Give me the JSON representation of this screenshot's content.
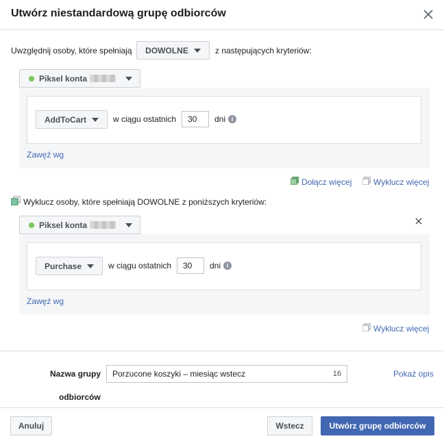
{
  "dialog": {
    "title": "Utwórz niestandardową grupę odbiorców"
  },
  "include": {
    "prefix": "Uwzględnij osoby, które spełniają",
    "match_select": "DOWOLNE",
    "suffix": "z następujących kryteriów:",
    "source_label": "Piksel konta",
    "event_select": "AddToCart",
    "within_label": "w ciągu ostatnich",
    "days_value": "30",
    "days_unit": "dni",
    "refine_link": "Zawęź wg",
    "add_more": "Dołącz więcej",
    "exclude_more": "Wyklucz więcej"
  },
  "exclude": {
    "header_text": "Wyklucz osoby, które spełniają DOWOLNE z poniższych kryteriów:",
    "source_label": "Piksel konta",
    "event_select": "Purchase",
    "within_label": "w ciągu ostatnich",
    "days_value": "30",
    "days_unit": "dni",
    "refine_link": "Zawęź wg",
    "exclude_more": "Wyklucz więcej"
  },
  "audience_name": {
    "label_line1": "Nazwa grupy",
    "label_line2": "odbiorców",
    "value": "Porzucone koszyki – miesiąc wstecz",
    "char_count": "16",
    "show_desc": "Pokaż opis"
  },
  "footer": {
    "cancel": "Anuluj",
    "back": "Wstecz",
    "create": "Utwórz grupę odbiorców"
  },
  "colors": {
    "accent": "#4267b2",
    "status_dot": "#7bc65a"
  }
}
